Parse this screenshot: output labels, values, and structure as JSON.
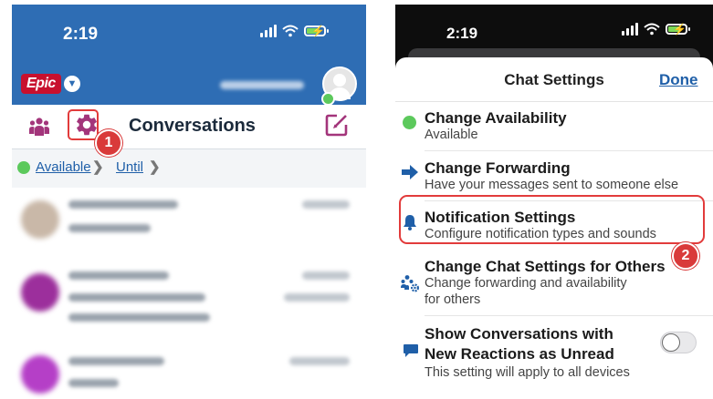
{
  "left_screen": {
    "status_bar": {
      "time": "2:19"
    },
    "app_bar": {
      "logo_text": "Epic"
    },
    "toolbar": {
      "title": "Conversations"
    },
    "availability": {
      "status_label": "Available",
      "until_label": "Until"
    },
    "callout": "1"
  },
  "right_screen": {
    "status_bar": {
      "time": "2:19"
    },
    "sheet": {
      "title": "Chat Settings",
      "done_label": "Done",
      "items": [
        {
          "title": "Change Availability",
          "subtitle": "Available",
          "icon": "green-status-dot-icon"
        },
        {
          "title": "Change Forwarding",
          "subtitle": "Have your messages sent to someone else",
          "icon": "arrow-right-icon"
        },
        {
          "title": "Notification Settings",
          "subtitle": "Configure notification types and sounds",
          "icon": "bell-icon"
        },
        {
          "title": "Change Chat Settings for Others",
          "subtitle_line1": "Change forwarding and availability",
          "subtitle_line2": "for others",
          "icon": "people-gear-icon"
        },
        {
          "title_line1": "Show Conversations with",
          "title_line2": "New Reactions as Unread",
          "subtitle": "This setting will apply to all devices",
          "icon": "chat-bubble-icon",
          "toggle_on": false
        }
      ]
    },
    "callout": "2"
  },
  "colors": {
    "header_blue": "#2e6db4",
    "epic_red": "#c8102e",
    "accent_magenta": "#a3357b",
    "highlight_red": "#e23b3b",
    "link_blue": "#1f5fa8",
    "status_green": "#5cc95c"
  }
}
